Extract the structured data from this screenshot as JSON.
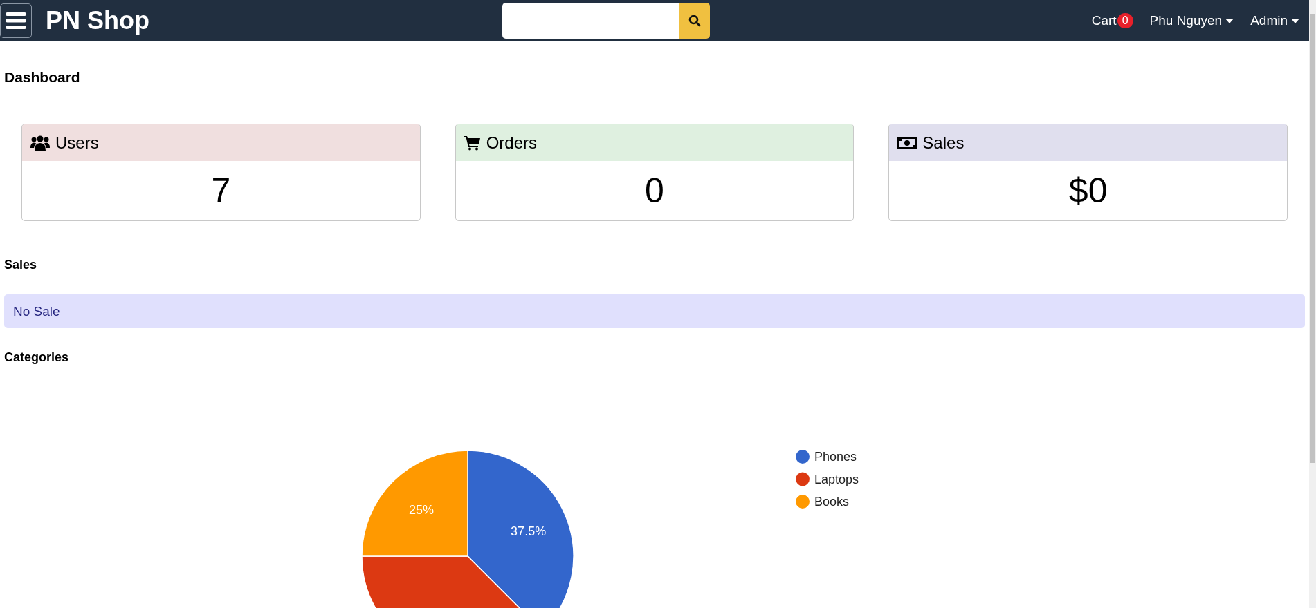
{
  "navbar": {
    "brand": "PN Shop",
    "cart": {
      "label": "Cart",
      "count": "0"
    },
    "menus": [
      "Phu Nguyen",
      "Admin"
    ]
  },
  "page_title": "Dashboard",
  "stat_cards": [
    {
      "title": "Users",
      "kind": "users",
      "value": "7",
      "color": "#f0dfdf"
    },
    {
      "title": "Orders",
      "kind": "orders",
      "value": "0",
      "color": "#dff0e0"
    },
    {
      "title": "Sales",
      "kind": "sales",
      "value": "$0",
      "color": "#e0dfee"
    }
  ],
  "sales": {
    "heading": "Sales",
    "message": "No Sale"
  },
  "categories": {
    "heading": "Categories",
    "chart_data": {
      "type": "pie",
      "categories": [
        "Phones",
        "Laptops",
        "Books"
      ],
      "values": [
        37.5,
        37.5,
        25
      ],
      "colors": [
        "#3366cc",
        "#dc3912",
        "#ff9900"
      ],
      "value_labels": [
        "37.5%",
        null,
        "25%"
      ],
      "legend": "right"
    }
  }
}
